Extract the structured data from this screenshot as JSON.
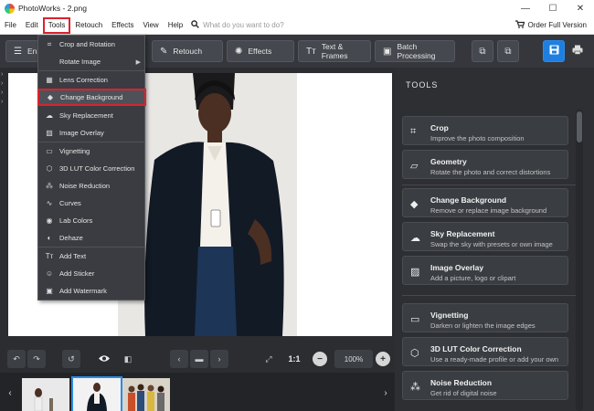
{
  "window": {
    "title": "PhotoWorks - 2.png",
    "min": "—",
    "max": "☐",
    "close": "✕"
  },
  "menubar": {
    "items": [
      "File",
      "Edit",
      "Tools",
      "Retouch",
      "Effects",
      "View",
      "Help"
    ],
    "search_placeholder": "What do you want to do?",
    "order": "Order Full Version"
  },
  "toolbar": {
    "enhance_label": "Enh",
    "retouch_label": "Retouch",
    "effects_label": "Effects",
    "text_frames_label": "Text & Frames",
    "batch_label": "Batch Processing"
  },
  "tools_menu": {
    "items": [
      {
        "label": "Crop and Rotation",
        "icon": "crop-icon"
      },
      {
        "label": "Rotate Image",
        "icon": "rotate-icon"
      },
      {
        "label": "Lens Correction",
        "icon": "lens-icon"
      },
      {
        "label": "Change Background",
        "icon": "background-icon"
      },
      {
        "label": "Sky Replacement",
        "icon": "sky-icon"
      },
      {
        "label": "Image Overlay",
        "icon": "overlay-icon"
      },
      {
        "label": "Vignetting",
        "icon": "vignette-icon"
      },
      {
        "label": "3D LUT Color Correction",
        "icon": "lut-icon"
      },
      {
        "label": "Noise Reduction",
        "icon": "noise-icon"
      },
      {
        "label": "Curves",
        "icon": "curves-icon"
      },
      {
        "label": "Lab Colors",
        "icon": "lab-icon"
      },
      {
        "label": "Dehaze",
        "icon": "dehaze-icon"
      },
      {
        "label": "Add Text",
        "icon": "text-icon"
      },
      {
        "label": "Add Sticker",
        "icon": "sticker-icon"
      },
      {
        "label": "Add Watermark",
        "icon": "watermark-icon"
      }
    ]
  },
  "tools_panel": {
    "heading": "TOOLS",
    "cards": [
      {
        "title": "Crop",
        "desc": "Improve the photo composition",
        "icon": "crop-icon"
      },
      {
        "title": "Geometry",
        "desc": "Rotate the photo and correct distortions",
        "icon": "geometry-icon"
      },
      {
        "title": "Change Background",
        "desc": "Remove or replace image background",
        "icon": "background-icon"
      },
      {
        "title": "Sky Replacement",
        "desc": "Swap the sky with presets or own image",
        "icon": "sky-icon"
      },
      {
        "title": "Image Overlay",
        "desc": "Add a picture, logo or clipart",
        "icon": "overlay-icon"
      },
      {
        "title": "Vignetting",
        "desc": "Darken or lighten the image edges",
        "icon": "vignette-icon"
      },
      {
        "title": "3D LUT Color Correction",
        "desc": "Use a ready-made profile or add your own",
        "icon": "lut-icon"
      },
      {
        "title": "Noise Reduction",
        "desc": "Get rid of digital noise",
        "icon": "noise-icon"
      }
    ]
  },
  "bottombar": {
    "ratio": "1:1",
    "zoom": "100%"
  },
  "filmstrip": {
    "selected_index": 1
  },
  "colors": {
    "accent": "#2b8bea",
    "highlight_border": "#d9232e",
    "panel": "#2d2f33"
  }
}
